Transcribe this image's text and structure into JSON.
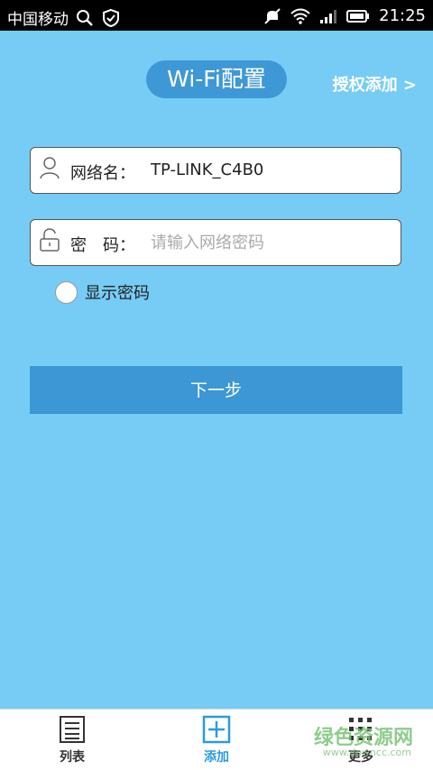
{
  "status_bar": {
    "carrier": "中国移动",
    "time": "21:25"
  },
  "header": {
    "title": "Wi-Fi配置",
    "auth_link": "授权添加 >"
  },
  "form": {
    "ssid_label": "网络名：",
    "ssid_value": "TP-LINK_C4B0",
    "password_label": "密　码：",
    "password_placeholder": "请输入网络密码",
    "show_password_label": "显示密码",
    "next_button": "下一步"
  },
  "bottom_nav": {
    "items": [
      {
        "label": "列表",
        "icon": "list-icon",
        "active": false
      },
      {
        "label": "添加",
        "icon": "add-icon",
        "active": true
      },
      {
        "label": "更多",
        "icon": "more-icon",
        "active": false
      }
    ]
  },
  "watermark": {
    "text": "绿色资源网",
    "sub": "www.downcc.com"
  },
  "colors": {
    "background": "#76ccf4",
    "accent": "#3c97d4",
    "active_nav": "#2a9be0"
  }
}
